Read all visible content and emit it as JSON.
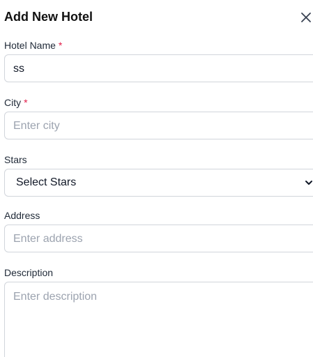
{
  "dialog": {
    "title": "Add New Hotel",
    "close_icon": "close-icon"
  },
  "fields": {
    "hotel_name": {
      "label": "Hotel Name",
      "required": "*",
      "value": "ss",
      "placeholder": ""
    },
    "city": {
      "label": "City",
      "required": "*",
      "value": "",
      "placeholder": "Enter city"
    },
    "stars": {
      "label": "Stars",
      "selected": "Select Stars",
      "icon": "chevron-down-icon"
    },
    "address": {
      "label": "Address",
      "value": "",
      "placeholder": "Enter address"
    },
    "description": {
      "label": "Description",
      "value": "",
      "placeholder": "Enter description"
    }
  },
  "colors": {
    "required_marker": "#e11d48",
    "border": "#d1d5db",
    "placeholder": "#9ca3af"
  }
}
